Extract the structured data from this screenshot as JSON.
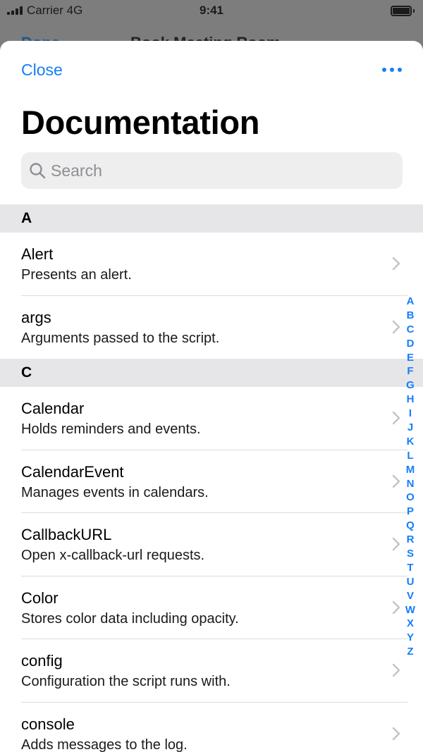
{
  "status_bar": {
    "carrier": "Carrier 4G",
    "time": "9:41"
  },
  "background_nav": {
    "done": "Done",
    "title": "Book Meeting Room"
  },
  "sheet": {
    "close_label": "Close",
    "more_icon": "ellipsis-icon",
    "title": "Documentation",
    "search": {
      "placeholder": "Search",
      "value": ""
    }
  },
  "sections": [
    {
      "letter": "A",
      "items": [
        {
          "title": "Alert",
          "subtitle": "Presents an alert."
        },
        {
          "title": "args",
          "subtitle": "Arguments passed to the script."
        }
      ]
    },
    {
      "letter": "C",
      "items": [
        {
          "title": "Calendar",
          "subtitle": "Holds reminders and events."
        },
        {
          "title": "CalendarEvent",
          "subtitle": "Manages events in calendars."
        },
        {
          "title": "CallbackURL",
          "subtitle": "Open x-callback-url requests."
        },
        {
          "title": "Color",
          "subtitle": "Stores color data including opacity."
        },
        {
          "title": "config",
          "subtitle": "Configuration the script runs with."
        },
        {
          "title": "console",
          "subtitle": "Adds messages to the log."
        }
      ]
    }
  ],
  "index_letters": [
    "A",
    "B",
    "C",
    "D",
    "E",
    "F",
    "G",
    "H",
    "I",
    "J",
    "K",
    "L",
    "M",
    "N",
    "O",
    "P",
    "Q",
    "R",
    "S",
    "T",
    "U",
    "V",
    "W",
    "X",
    "Y",
    "Z"
  ],
  "colors": {
    "accent": "#147EFB",
    "section_bg": "#e6e6e8",
    "search_bg": "#eeeeef"
  }
}
